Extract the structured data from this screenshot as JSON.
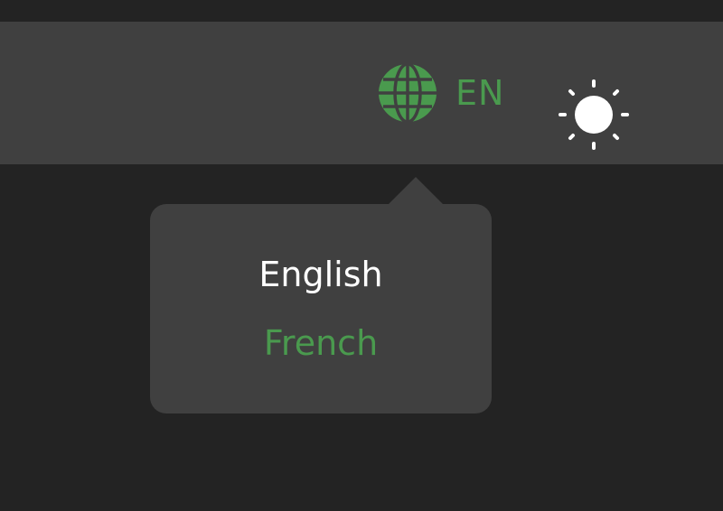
{
  "colors": {
    "background": "#232323",
    "header_background": "#404040",
    "accent": "#4a9a4e",
    "text_primary": "#ffffff"
  },
  "header": {
    "language_toggle": {
      "icon": "globe-icon",
      "code": "EN"
    },
    "theme_toggle": {
      "icon": "sun-icon"
    }
  },
  "language_dropdown": {
    "items": [
      {
        "label": "English",
        "state": "current"
      },
      {
        "label": "French",
        "state": "option"
      }
    ]
  }
}
